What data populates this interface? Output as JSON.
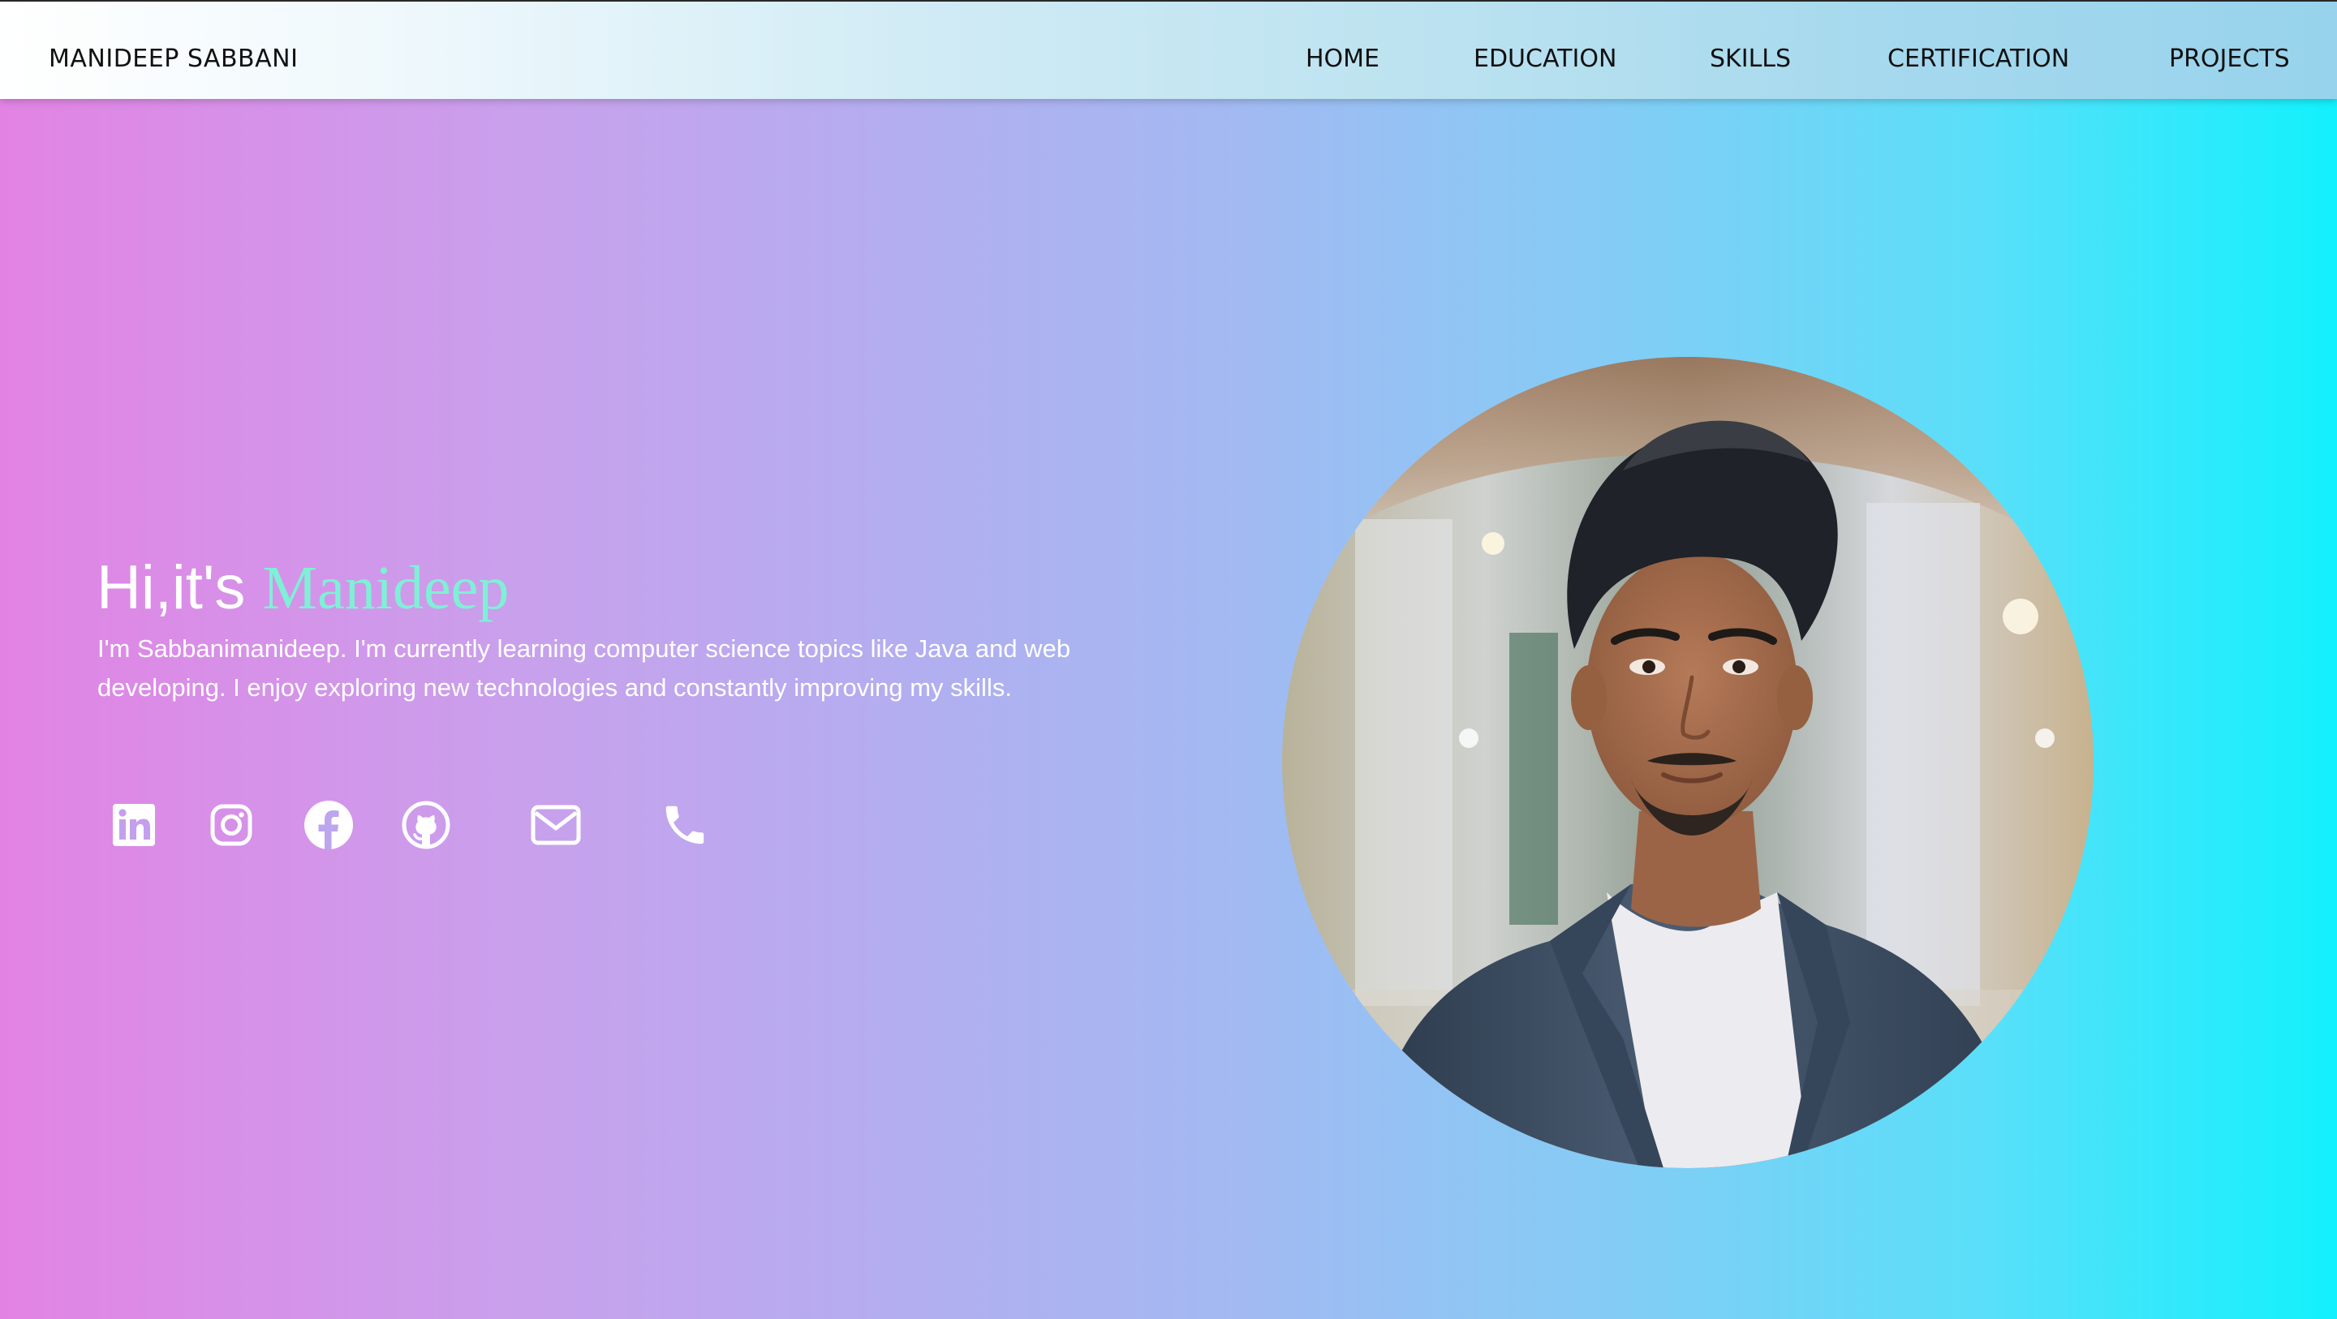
{
  "nav": {
    "brand": "MANIDEEP SABBANI",
    "links": [
      "HOME",
      "EDUCATION",
      "SKILLS",
      "CERTIFICATION",
      "PROJECTS"
    ]
  },
  "hero": {
    "greeting": "Hi,it's ",
    "name": "Manideep",
    "description": "I'm Sabbanimanideep. I'm currently learning computer science topics like Java and web developing. I enjoy exploring new technologies and constantly improving my skills."
  },
  "social_icons": [
    "linkedin-icon",
    "instagram-icon",
    "facebook-icon",
    "github-icon",
    "mail-icon",
    "phone-icon"
  ],
  "colors": {
    "accent_name": "#7ff0d6",
    "gradient_left": "#e283e4",
    "gradient_right": "#12f1fd",
    "text_light": "#ffffff",
    "nav_text": "#111111"
  }
}
